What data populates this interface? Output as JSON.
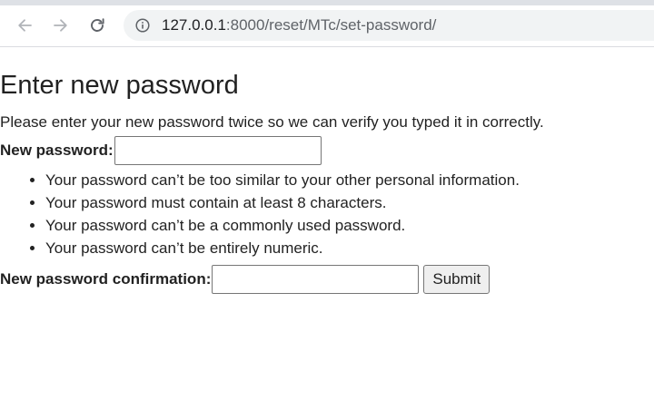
{
  "browser": {
    "url_host": "127.0.0.1",
    "url_rest": ":8000/reset/MTc/set-password/"
  },
  "page": {
    "title": "Enter new password",
    "intro": "Please enter your new password twice so we can verify you typed it in correctly.",
    "new_password_label": "New password:",
    "new_password_value": "",
    "help_items": [
      "Your password can’t be too similar to your other personal information.",
      "Your password must contain at least 8 characters.",
      "Your password can’t be a commonly used password.",
      "Your password can’t be entirely numeric."
    ],
    "confirm_label": "New password confirmation:",
    "confirm_value": "",
    "submit_label": "Submit"
  },
  "icons": {
    "back": "arrow-left-icon",
    "forward": "arrow-right-icon",
    "reload": "reload-icon",
    "info": "info-icon"
  }
}
